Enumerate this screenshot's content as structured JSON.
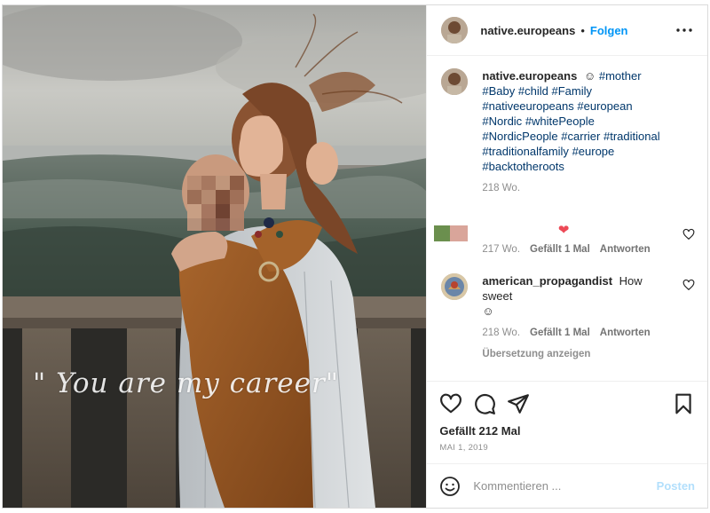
{
  "post": {
    "image_overlay_text": "\" You are my career\"",
    "author": "native.europeans",
    "separator": "•",
    "follow_label": "Folgen"
  },
  "caption": {
    "username": "native.europeans",
    "emoji": "☺",
    "tags": [
      "#mother",
      "#Baby",
      "#child",
      "#Family",
      "#nativeeuropeans",
      "#european",
      "#Nordic",
      "#whitePeople",
      "#NordicPeople",
      "#carrier",
      "#traditional",
      "#traditionalfamily",
      "#europe",
      "#backtotheroots"
    ],
    "time": "218 Wo."
  },
  "comments": [
    {
      "avatar": "flag-avatar",
      "text_emoji": "❤",
      "time": "217 Wo.",
      "likes": "Gefällt 1 Mal",
      "reply": "Antworten"
    },
    {
      "username": "american_propagandist",
      "text": "How sweet",
      "emoji": "☺",
      "time": "218 Wo.",
      "likes": "Gefällt 1 Mal",
      "reply": "Antworten",
      "translate": "Übersetzung anzeigen"
    }
  ],
  "actions": {
    "likes": "Gefällt 212 Mal",
    "date": "MAI 1, 2019"
  },
  "composer": {
    "placeholder": "Kommentieren ...",
    "post_label": "Posten"
  },
  "colors": {
    "link_blue": "#0095f6",
    "hashtag": "#00376b",
    "muted": "#8e8e8e",
    "heart_red": "#ed4956"
  }
}
